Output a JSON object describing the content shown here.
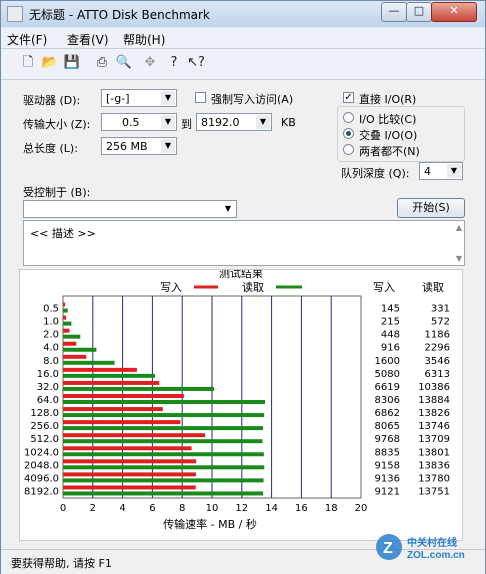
{
  "window": {
    "title": "无标题 - ATTO Disk Benchmark",
    "min_label": "—",
    "max_label": "□",
    "close_label": "✕"
  },
  "menu": [
    "文件(F)",
    "查看(V)",
    "帮助(H)"
  ],
  "toolbar": [
    "new-icon",
    "open-icon",
    "save-icon",
    "print-icon",
    "print-preview-icon",
    "move-icon",
    "help-icon",
    "context-help-icon"
  ],
  "settings": {
    "drive_label": "驱动器 (D):",
    "drive_value": "[-g-]",
    "transfer_label": "传输大小 (Z):",
    "transfer_from": "0.5",
    "to_label": "到",
    "transfer_to": "8192.0",
    "kb_label": "KB",
    "length_label": "总长度 (L):",
    "length_value": "256 MB",
    "force_write_label": "强制写入访问(A)",
    "force_write_checked": false,
    "direct_io_label": "直接 I/O(R)",
    "direct_io_checked": true,
    "io_compare_label": "I/O 比较(C)",
    "overlapped_io_label": "交叠 I/O(O)",
    "neither_label": "两者都不(N)",
    "selected_mode": "overlapped",
    "queue_label": "队列深度 (Q):",
    "queue_value": "4",
    "controlled_label": "受控制于 (B):",
    "controlled_value": "",
    "start_button": "开始(S)",
    "description": "<< 描述 >>"
  },
  "chart_data": {
    "type": "bar",
    "orientation": "horizontal",
    "title": "测试结果",
    "xlabel": "传输速率 - MB / 秒",
    "xlim": [
      0,
      20
    ],
    "xticks": [
      "0",
      "2",
      "4",
      "6",
      "8",
      "10",
      "12",
      "14",
      "16",
      "18",
      "20"
    ],
    "categories": [
      "0.5",
      "1.0",
      "2.0",
      "4.0",
      "8.0",
      "16.0",
      "32.0",
      "64.0",
      "128.0",
      "256.0",
      "512.0",
      "1024.0",
      "2048.0",
      "4096.0",
      "8192.0"
    ],
    "series": [
      {
        "name": "写入",
        "color": "#e02020",
        "values": [
          0.14,
          0.21,
          0.44,
          0.89,
          1.56,
          4.96,
          6.46,
          8.11,
          6.7,
          7.88,
          9.54,
          8.63,
          8.94,
          8.92,
          8.91
        ]
      },
      {
        "name": "读取",
        "color": "#1a8a1a",
        "values": [
          0.32,
          0.56,
          1.16,
          2.24,
          3.46,
          6.17,
          10.14,
          13.56,
          13.5,
          13.42,
          13.39,
          13.48,
          13.51,
          13.46,
          13.43
        ]
      }
    ],
    "table_headers": [
      "写入",
      "读取"
    ],
    "table": [
      [
        "145",
        "331"
      ],
      [
        "215",
        "572"
      ],
      [
        "448",
        "1186"
      ],
      [
        "916",
        "2296"
      ],
      [
        "1600",
        "3546"
      ],
      [
        "5080",
        "6313"
      ],
      [
        "6619",
        "10386"
      ],
      [
        "8306",
        "13884"
      ],
      [
        "6862",
        "13826"
      ],
      [
        "8065",
        "13746"
      ],
      [
        "9768",
        "13709"
      ],
      [
        "8835",
        "13801"
      ],
      [
        "9158",
        "13836"
      ],
      [
        "9136",
        "13780"
      ],
      [
        "9121",
        "13751"
      ]
    ]
  },
  "status": "要获得帮助, 请按 F1",
  "watermark": "中关村在线 zol.com.cn"
}
